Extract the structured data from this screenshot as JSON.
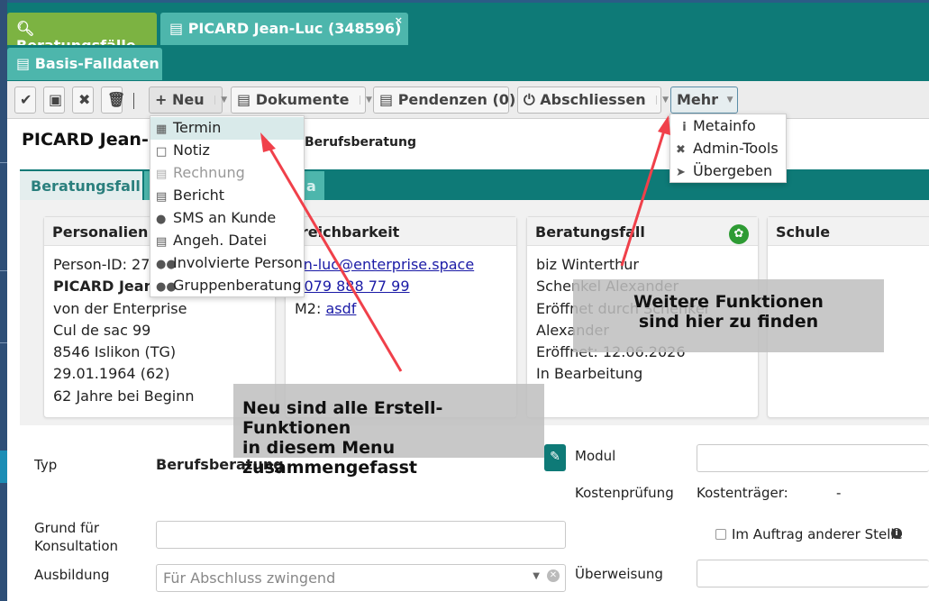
{
  "tabs": {
    "search_label": "Beratungsfälle",
    "person_label": "PICARD Jean-Luc (348596)",
    "close_glyph": "×",
    "basis_label": "Basis-Falldaten"
  },
  "toolbar": {
    "new_label": "Neu",
    "documents_label": "Dokumente",
    "pending_label": "Pendenzen (0)",
    "close_label": "Abschliessen",
    "more_label": "Mehr"
  },
  "header": {
    "title": "PICARD Jean-",
    "subtitle": "Berufsberatung"
  },
  "content_tabs": {
    "active": "Beratungsfall",
    "second": "a"
  },
  "cards": {
    "personalien": {
      "title": "Personalien",
      "lines": [
        "Person-ID: 279",
        "PICARD Jean-",
        "von der Enterprise",
        "Cul de sac 99",
        "8546 Islikon (TG)",
        "29.01.1964 (62)",
        "62 Jahre bei Beginn"
      ]
    },
    "erreichbarkeit": {
      "title": "rreichbarkeit",
      "email": "an-luc@enterprise.space",
      "phone_prefix": ":",
      "phone": "079 888 77 99",
      "m2_label": "M2:",
      "m2_value": "asdf"
    },
    "beratungsfall": {
      "title": "Beratungsfall",
      "lines": [
        "biz Winterthur",
        "Schenkel Alexander",
        "Eröffnet durch Schenkel",
        "Alexander",
        "Eröffnet: 12.06.2026",
        "In Bearbeitung"
      ]
    },
    "schule": {
      "title": "Schule"
    }
  },
  "form": {
    "typ_label": "Typ",
    "typ_value": "Berufsberatung",
    "grund_label": "Grund für\nKonsultation",
    "ausbildung_label": "Ausbildung",
    "ausbildung_placeholder": "Für Abschluss zwingend",
    "modul_label": "Modul",
    "kostenpruefung_label": "Kostenprüfung",
    "kostentraeger_label": "Kostenträger:",
    "kostentraeger_value": "-",
    "auftrag_label": "Im Auftrag anderer Stelle",
    "ueberweisung_label": "Überweisung"
  },
  "neu_menu": {
    "items": [
      {
        "label": "Termin",
        "icon": "calendar-icon"
      },
      {
        "label": "Notiz",
        "icon": "note-icon"
      },
      {
        "label": "Rechnung",
        "icon": "invoice-icon"
      },
      {
        "label": "Bericht",
        "icon": "report-icon"
      },
      {
        "label": "SMS an Kunde",
        "icon": "chat-icon"
      },
      {
        "label": "Angeh. Datei",
        "icon": "file-icon"
      },
      {
        "label": "Involvierte Person",
        "icon": "people-icon"
      },
      {
        "label": "Gruppenberatung",
        "icon": "group-icon"
      }
    ]
  },
  "mehr_menu": {
    "items": [
      {
        "label": "Metainfo",
        "icon": "info-icon"
      },
      {
        "label": "Admin-Tools",
        "icon": "tools-icon"
      },
      {
        "label": "Übergeben",
        "icon": "send-icon"
      }
    ]
  },
  "callouts": {
    "neu_line1": "Neu sind alle Erstell-Funktionen",
    "neu_line2": "in diesem Menu zusammengefasst",
    "mehr_line1": "Weitere Funktionen",
    "mehr_line2": "sind hier zu finden"
  },
  "colors": {
    "teal": "#0e7a77",
    "light_teal": "#4db6ac",
    "green_tab": "#7cb342",
    "arrow_red": "#f0404a"
  }
}
